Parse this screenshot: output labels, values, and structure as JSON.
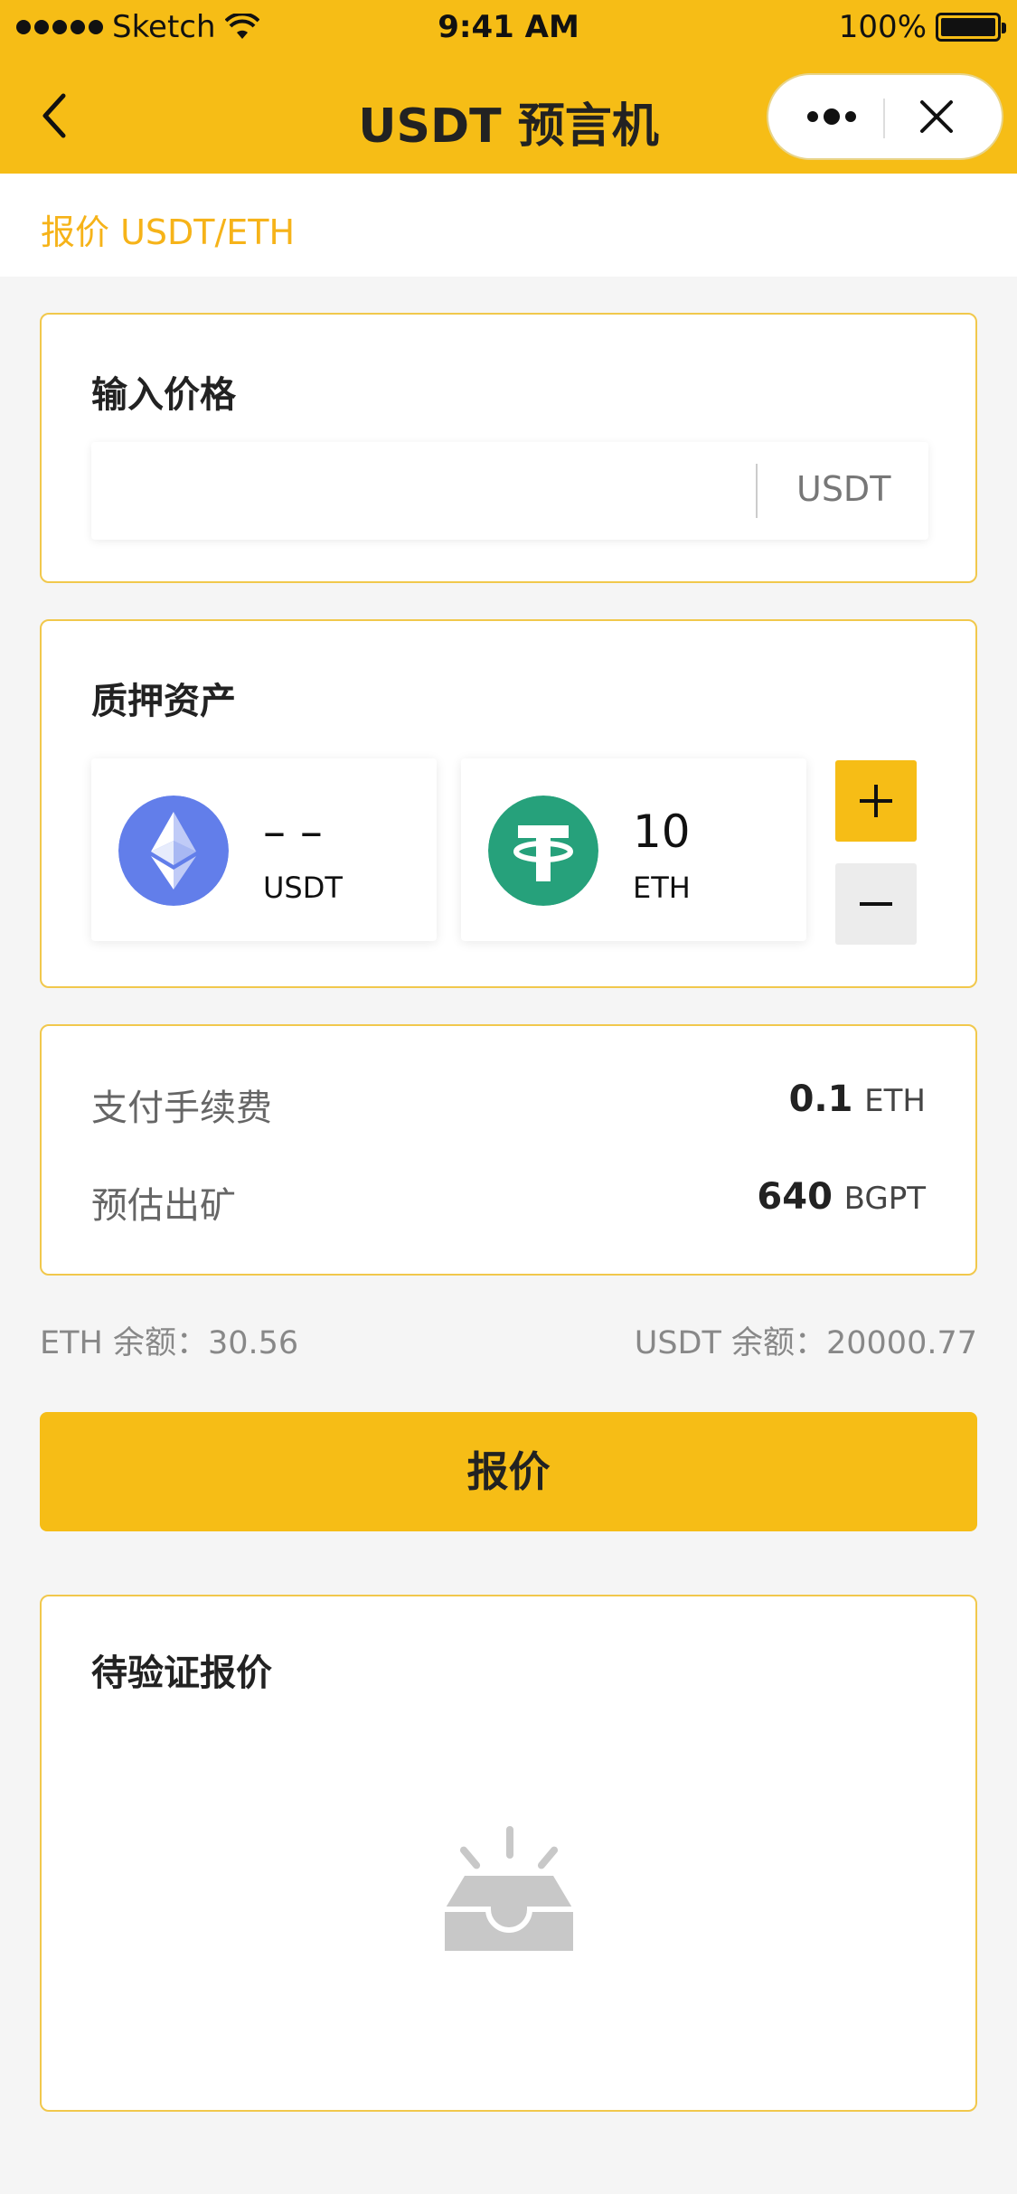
{
  "status_bar": {
    "carrier": "Sketch",
    "time": "9:41 AM",
    "battery": "100%"
  },
  "nav": {
    "title": "USDT 预言机"
  },
  "subheader": {
    "label": "报价 USDT/ETH"
  },
  "price_card": {
    "title": "输入价格",
    "input_value": "",
    "unit": "USDT"
  },
  "collateral_card": {
    "title": "质押资产",
    "assets": [
      {
        "icon": "ethereum-icon",
        "value": "– –",
        "currency": "USDT",
        "color": "#627eea"
      },
      {
        "icon": "tether-icon",
        "value": "10",
        "currency": "ETH",
        "color": "#26a17b"
      }
    ],
    "plus_icon": "plus-icon",
    "minus_icon": "minus-icon"
  },
  "fee_card": {
    "rows": [
      {
        "label": "支付手续费",
        "amount": "0.1",
        "unit": "ETH"
      },
      {
        "label": "预估出矿",
        "amount": "640",
        "unit": "BGPT"
      }
    ]
  },
  "balances": {
    "eth": "ETH 余额：30.56",
    "usdt": "USDT 余额：20000.77"
  },
  "quote_button": {
    "label": "报价"
  },
  "pending_card": {
    "title": "待验证报价",
    "empty_icon": "empty-inbox-icon"
  },
  "colors": {
    "accent": "#f6bd16",
    "card_border": "#f1c84c",
    "background": "#f5f5f5"
  }
}
